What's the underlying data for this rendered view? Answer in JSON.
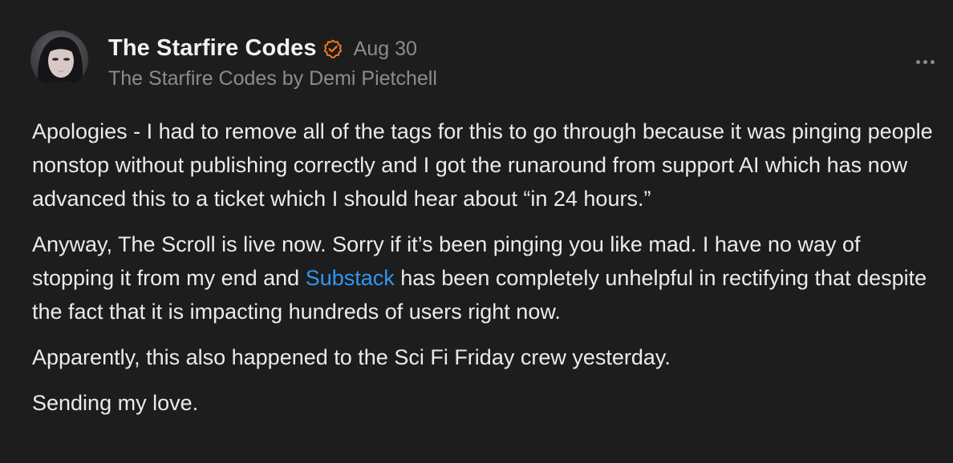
{
  "post": {
    "author": "The Starfire Codes",
    "date": "Aug 30",
    "byline": "The Starfire Codes by Demi Pietchell",
    "accent_color": "#f5781e",
    "link_color": "#2f97f2",
    "avatar_icon": "profile-photo",
    "verified_icon": "verified-check-icon",
    "more_icon": "ellipsis-icon",
    "paragraphs": {
      "p1": "Apologies - I had to remove all of the tags for this to go through because it was pinging people nonstop without publishing correctly and I got the runaround from support AI which has now advanced this to a ticket which I should hear about “in 24 hours.”",
      "p2_before": "Anyway, The Scroll is live now. Sorry if it’s been pinging you like mad. I have no way of stopping it from my end and ",
      "p2_link": "Substack",
      "p2_after": " has been completely unhelpful in rectifying that despite the fact that it is impacting hundreds of users right now.",
      "p3": "Apparently, this also happened to the Sci Fi Friday crew yesterday.",
      "p4": "Sending my love."
    }
  }
}
